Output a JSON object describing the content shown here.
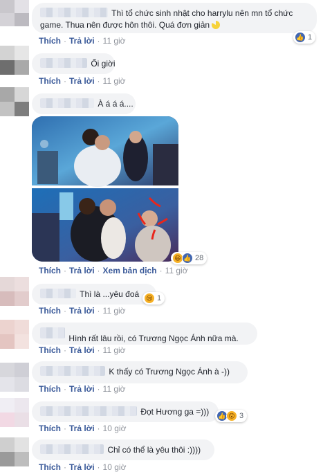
{
  "labels": {
    "like": "Thích",
    "reply": "Trả lời",
    "translate": "Xem bản dịch"
  },
  "comments": [
    {
      "text_line1": "Thì tổ chức sinh nhật cho harrylu nên mn tổ chức",
      "text_line2": "game. Thua nên được hôn thôi. Quá đơn giản",
      "time": "11 giờ",
      "reactions": {
        "icons": [
          "like-icon"
        ],
        "count": "1"
      }
    },
    {
      "text": "Ối giời",
      "time": "11 giờ"
    },
    {
      "text": "À á á á....",
      "time": "11 giờ",
      "reactions": {
        "icons": [
          "haha-icon",
          "like-icon"
        ],
        "count": "28"
      }
    },
    {
      "text": "Thì là ...yêu đoá",
      "time": "11 giờ",
      "reactions": {
        "icons": [
          "sad-icon"
        ],
        "count": "1"
      }
    },
    {
      "text": "Hình rất lâu rồi, có Trương Ngọc Ánh nữa mà.",
      "time": "11 giờ"
    },
    {
      "text": "K thấy có Trương Ngọc Ánh à -))",
      "time": "11 giờ"
    },
    {
      "text": "Đọt Hương ga =)))",
      "time": "10 giờ",
      "reactions": {
        "icons": [
          "like-icon",
          "wow-icon"
        ],
        "count": "3"
      }
    },
    {
      "text": "Chỉ có thể là yêu thôi :))))",
      "time": "10 giờ"
    }
  ],
  "colors": {
    "bubble": "#f2f3f5",
    "link": "#4b4f56",
    "link_blue": "#385898",
    "meta": "#90949c",
    "like_blue": "#4267b2",
    "annotation_red": "#e8261c"
  }
}
